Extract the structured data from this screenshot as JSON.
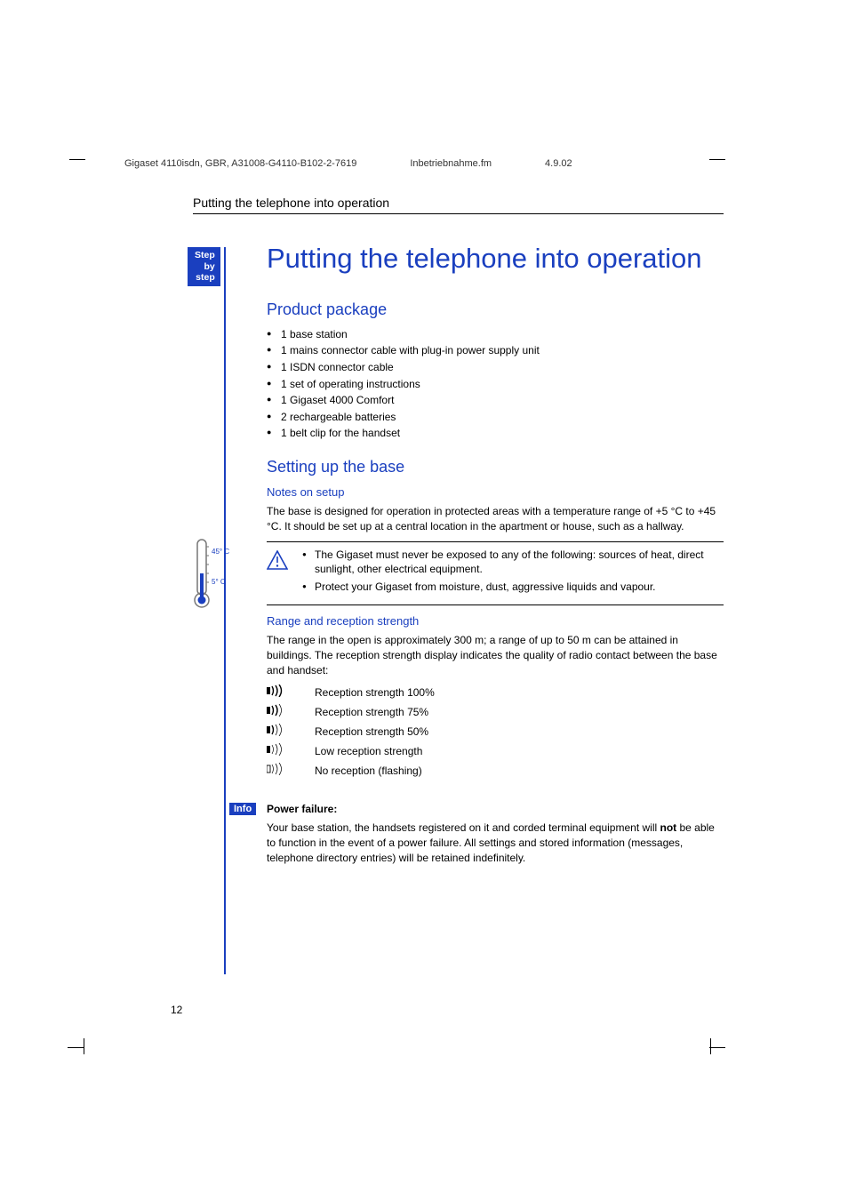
{
  "header": {
    "doc_id": "Gigaset 4110isdn, GBR, A31008-G4110-B102-2-7619",
    "file": "Inbetriebnahme.fm",
    "date": "4.9.02"
  },
  "running_head": "Putting the telephone into operation",
  "sidebar_tag": {
    "l1": "Step",
    "l2": "by",
    "l3": "step"
  },
  "title": "Putting the telephone into operation",
  "product_package": {
    "heading": "Product package",
    "items": [
      "1 base station",
      "1 mains connector cable with plug-in power supply unit",
      "1 ISDN connector cable",
      "1 set of operating instructions",
      "1 Gigaset 4000 Comfort",
      "2 rechargeable batteries",
      "1 belt clip for the handset"
    ]
  },
  "setup": {
    "heading": "Setting up the base",
    "notes_heading": "Notes on setup",
    "notes_body": "The base is designed for operation in protected areas with a temperature range of +5 °C to +45 °C. It should be set up at a central location in the apartment or house, such as a hallway.",
    "thermo_high": "45° C",
    "thermo_low": "5° C",
    "caution": [
      "The Gigaset must never be exposed to any of the following: sources of heat, direct sunlight, other electrical equipment.",
      "Protect your Gigaset from moisture, dust, aggressive liquids and vapour."
    ],
    "range_heading": "Range and reception strength",
    "range_body": "The range in the open is approximately 300 m; a range of up to 50 m can be attained in buildings. The reception strength display indicates the quality of radio contact between the base and handset:",
    "signals": [
      {
        "label": "Reception strength 100%"
      },
      {
        "label": "Reception strength 75%"
      },
      {
        "label": "Reception strength 50%"
      },
      {
        "label": "Low reception strength"
      },
      {
        "label": "No reception (flashing)"
      }
    ]
  },
  "info": {
    "tag": "Info",
    "title": "Power failure:",
    "body_pre": "Your base station, the handsets registered on it and corded terminal equipment will ",
    "body_bold": "not",
    "body_post": " be able to function in the event of a power failure. All settings and stored information (messages, telephone directory entries) will be retained indefinitely."
  },
  "page_number": "12"
}
